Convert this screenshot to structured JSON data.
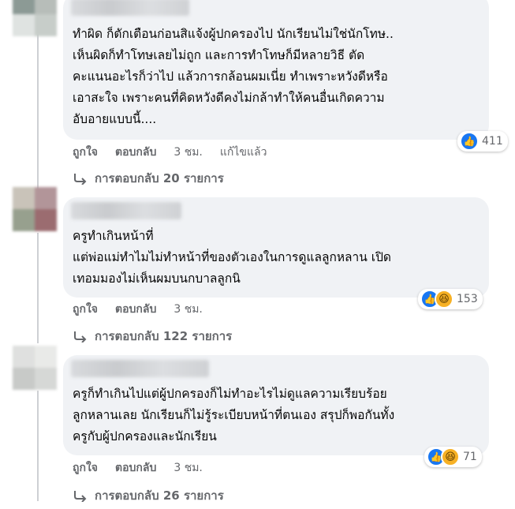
{
  "comments": [
    {
      "text": "ทำผิด ก็ตักเตือนก่อนสิแจ้งผู้ปกครองไป นักเรียนไม่ใช่นักโทษ..\nเห็นผิดก็ทำโทษเลยไม่ถูก และการทำโทษก็มีหลายวิธี ตัด\nคะแนนอะไรก็ว่าไป แล้วการกล้อนผมเนี่ย ทำเพราะหวังดีหรือ\nเอาสะใจ เพราะคนที่คิดหวังดีคงไม่กล้าทำให้คนอื่นเกิดความ\nอับอายแบบนี้....",
      "like_label": "ถูกใจ",
      "reply_label": "ตอบกลับ",
      "time": "3 ชม.",
      "edited": "แก้ไขแล้ว",
      "reaction_count": "411",
      "reactions": [
        "like-icon"
      ],
      "replies_label": "การตอบกลับ 20 รายการ"
    },
    {
      "text": "ครูทำเกินหน้าที่\nแต่พ่อแม่ทำไมไม่ทำหน้าที่ของตัวเองในการดูแลลูกหลาน เปิด\nเทอมมองไม่เห็นผมบนกบาลลูกนิ",
      "like_label": "ถูกใจ",
      "reply_label": "ตอบกลับ",
      "time": "3 ชม.",
      "reaction_count": "153",
      "reactions": [
        "like-icon",
        "haha-icon"
      ],
      "replies_label": "การตอบกลับ 122 รายการ"
    },
    {
      "text": "ครูก็ทำเกินไปแต่ผู้ปกครองก็ไม่ทำอะไรไม่ดูแลความเรียบร้อย\nลูกหลานเลย นักเรียนก็ไม่รู้ระเบียบหน้าที่ตนเอง สรุปก็พอกันทั้ง\nครูกับผู้ปกครองและนักเรียน",
      "like_label": "ถูกใจ",
      "reply_label": "ตอบกลับ",
      "time": "3 ชม.",
      "reaction_count": "71",
      "reactions": [
        "like-icon",
        "haha-icon"
      ],
      "replies_label": "การตอบกลับ 26 รายการ"
    }
  ],
  "colors": {
    "bubble": "#f0f2f5",
    "like": "#1877f2",
    "haha": "#f7b125",
    "secondary_text": "#65676b",
    "thread_line": "#ced0d4"
  }
}
